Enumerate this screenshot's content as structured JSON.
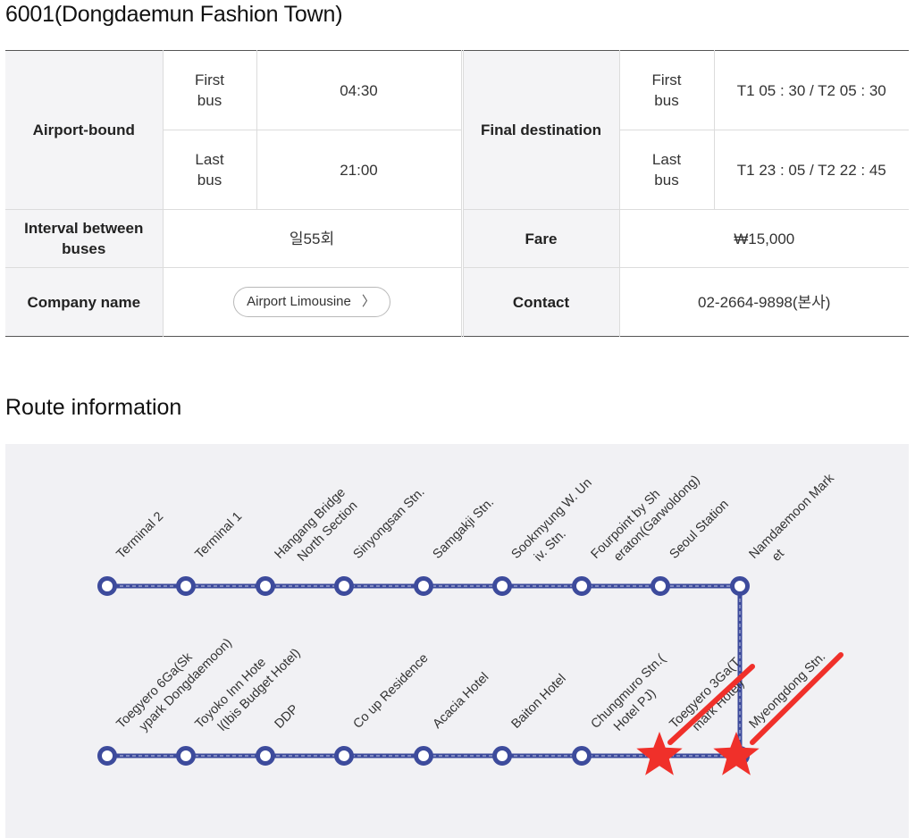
{
  "page_title": "6001(Dongdaemun Fashion Town)",
  "schedule": {
    "airport_bound_label": "Airport-bound",
    "final_destination_label": "Final destination",
    "first_bus_label_1": "First",
    "first_bus_label_2": "bus",
    "last_bus_label_1": "Last",
    "last_bus_label_2": "bus",
    "airport_first": "04:30",
    "airport_last": "21:00",
    "dest_first": "T1 05 : 30 / T2 05 : 30",
    "dest_last": "T1 23 : 05 / T2 22 : 45"
  },
  "details": {
    "interval_label_1": "Interval between",
    "interval_label_2": "buses",
    "interval_value": "일55회",
    "fare_label": "Fare",
    "fare_value": "₩15,000",
    "company_label": "Company name",
    "company_button": "Airport Limousine",
    "contact_label": "Contact",
    "contact_value": "02-2664-9898(본사)"
  },
  "route_title": "Route information",
  "route": {
    "line_color": "#3d4b9c",
    "marker_color": "#f0302a",
    "stops_top": [
      [
        "Terminal 2"
      ],
      [
        "Terminal 1"
      ],
      [
        "Hangang Bridge",
        "North Section"
      ],
      [
        "Sinyongsan Stn."
      ],
      [
        "Samgakji Stn."
      ],
      [
        "Sookmyung W. Un",
        "iv. Stn."
      ],
      [
        "Fourpoint by Sh",
        "eraton(Garwoldong)"
      ],
      [
        "Seoul Station"
      ],
      [
        "Namdaemoon Mark",
        "et"
      ]
    ],
    "stops_bottom": [
      [
        "Toegyero 6Ga(Sk",
        "ypark Dongdaemoon)"
      ],
      [
        "Toyoko Inn Hote",
        "l(Ibis Budget Hotel)"
      ],
      [
        "DDP"
      ],
      [
        "Co up Residence"
      ],
      [
        "Acacia Hotel"
      ],
      [
        "Baiton Hotel"
      ],
      [
        "Chungmuro Stn.(",
        "Hotel PJ)"
      ],
      [
        "Toegyero 3Ga(T",
        "mark Hotel)"
      ],
      [
        "Myeongdong Stn."
      ]
    ],
    "highlighted_stops": [
      "Toegyero 3Ga(Tmark Hotel)",
      "Myeongdong Stn."
    ]
  }
}
